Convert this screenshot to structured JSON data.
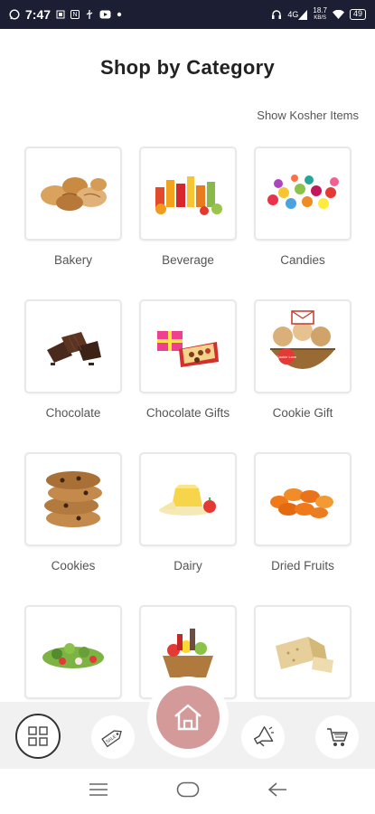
{
  "status_bar": {
    "time": "7:47",
    "left_icons": [
      "whatsapp-icon",
      "sim-icon",
      "notification-icon",
      "usb-icon",
      "youtube-icon",
      "dot-icon"
    ],
    "right_icons": [
      "headset-icon",
      "signal-icon",
      "wifi-icon"
    ],
    "data_speed": "18.7",
    "data_unit": "KB/S",
    "network": "4G",
    "battery": "49"
  },
  "header": {
    "title": "Shop by Category",
    "kosher_link": "Show Kosher Items"
  },
  "categories": [
    {
      "label": "Bakery",
      "icon": "bakery-image"
    },
    {
      "label": "Beverage",
      "icon": "beverage-image"
    },
    {
      "label": "Candies",
      "icon": "candies-image"
    },
    {
      "label": "Chocolate",
      "icon": "chocolate-image"
    },
    {
      "label": "Chocolate Gifts",
      "icon": "chocolate-gifts-image"
    },
    {
      "label": "Cookie Gift",
      "icon": "cookie-gift-image"
    },
    {
      "label": "Cookies",
      "icon": "cookies-image"
    },
    {
      "label": "Dairy",
      "icon": "dairy-image"
    },
    {
      "label": "Dried Fruits",
      "icon": "dried-fruits-image"
    },
    {
      "label": "",
      "icon": "salad-image"
    },
    {
      "label": "",
      "icon": "gift-basket-image"
    },
    {
      "label": "",
      "icon": "halva-image"
    }
  ],
  "cookie_gift_tag": "Cookie Love",
  "bottom_nav": {
    "items": [
      {
        "name": "categories",
        "icon": "grid-icon"
      },
      {
        "name": "sale",
        "icon": "sale-tag-icon",
        "text": "SALE"
      },
      {
        "name": "home",
        "icon": "home-icon"
      },
      {
        "name": "promotions",
        "icon": "megaphone-icon"
      },
      {
        "name": "cart",
        "icon": "cart-icon"
      }
    ],
    "home_color": "#d49a9a"
  },
  "colors": {
    "status_bar": "#1c1f33",
    "title": "#222222",
    "tile_border": "#e8e8e8",
    "nav_bg": "#f1f1f1"
  }
}
